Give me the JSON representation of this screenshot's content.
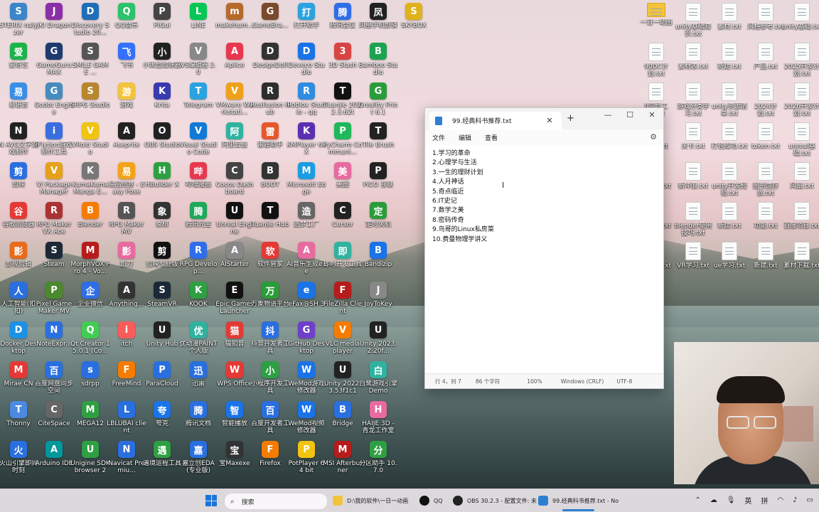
{
  "desktop": {
    "icons": [
      {
        "label": "STERIX nalyzer",
        "color": "#3a86c8"
      },
      {
        "label": "JKI Dragon",
        "color": "#8b2fa8"
      },
      {
        "label": "Discovery Studio 20...",
        "color": "#1e6fb8"
      },
      {
        "label": "QQ音乐",
        "color": "#2cc36b"
      },
      {
        "label": "PIGui",
        "color": "#444"
      },
      {
        "label": "LINE",
        "color": "#06c755"
      },
      {
        "label": "makehum...",
        "color": "#b56a2c"
      },
      {
        "label": "GameBra...",
        "color": "#7a4a2c"
      },
      {
        "label": "打开助手",
        "color": "#2aa3e0"
      },
      {
        "label": "腾讯会议",
        "color": "#2f6ee8"
      },
      {
        "label": "凤凰手机影驿",
        "color": "#222"
      },
      {
        "label": "SKYBOX",
        "color": "#e0b21a"
      },
      {
        "label": "爱奇艺",
        "color": "#1bb34a"
      },
      {
        "label": "GameGuru MAX",
        "color": "#1f3a6e"
      },
      {
        "label": "SMILE GAME ...",
        "color": "#555"
      },
      {
        "label": "飞书",
        "color": "#3370ff"
      },
      {
        "label": "小黑盒加速器",
        "color": "#222"
      },
      {
        "label": "VS编辑器 2.0",
        "color": "#888"
      },
      {
        "label": "Aplice",
        "color": "#e8384f"
      },
      {
        "label": "DesignDoll",
        "color": "#333"
      },
      {
        "label": "Deveco Studio",
        "color": "#1a73e8"
      },
      {
        "label": "3D Slash",
        "color": "#d94343"
      },
      {
        "label": "Bamboo Studio",
        "color": "#1ca34f"
      },
      {
        "label": "易语言",
        "color": "#3a8ee6"
      },
      {
        "label": "Godot Engine",
        "color": "#478cbf"
      },
      {
        "label": "SRPG Studio",
        "color": "#b8862d"
      },
      {
        "label": "游戏",
        "color": "#f3c33c"
      },
      {
        "label": "Krita",
        "color": "#3a3ab0"
      },
      {
        "label": "Telegram",
        "color": "#2aa3e0"
      },
      {
        "label": "VMware Workstati...",
        "color": "#f0a11a"
      },
      {
        "label": "Reallusion Hub",
        "color": "#2d2d2d"
      },
      {
        "label": "Roblox Studio - qq",
        "color": "#2f8ce0"
      },
      {
        "label": "Tuanjie 2022.3.62t",
        "color": "#111"
      },
      {
        "label": "Greality Print 6.1",
        "color": "#2a9d3a"
      },
      {
        "label": "N AVG文字游戏制作",
        "color": "#222"
      },
      {
        "label": "iFlytion游戏制作工具",
        "color": "#3a6ee0"
      },
      {
        "label": "VRoid Studio",
        "color": "#f1c40f"
      },
      {
        "label": "Aseprite",
        "color": "#222"
      },
      {
        "label": "OBS Studio",
        "color": "#222"
      },
      {
        "label": "Visual Studio Code",
        "color": "#0f7bd6"
      },
      {
        "label": "阿里云盘",
        "color": "#2fb3a0"
      },
      {
        "label": "雷霆助手",
        "color": "#e5572c"
      },
      {
        "label": "KMPlayer 64X",
        "color": "#5a2fb0"
      },
      {
        "label": "PyCharm Communi...",
        "color": "#1fb85a"
      },
      {
        "label": "Tile Brush",
        "color": "#222"
      },
      {
        "label": "剪映",
        "color": "#2a6fe0"
      },
      {
        "label": "VI Package Manager",
        "color": "#e5a11a"
      },
      {
        "label": "KumaKuma Manga E...",
        "color": "#777"
      },
      {
        "label": "易品创意 - Easy Pose",
        "color": "#f3a21a"
      },
      {
        "label": "HBuilder X",
        "color": "#2ea043"
      },
      {
        "label": "哔哩漫画",
        "color": "#e8384f"
      },
      {
        "label": "Cocos Dashboard",
        "color": "#444"
      },
      {
        "label": "BOOT",
        "color": "#333"
      },
      {
        "label": "Microsoft Edge",
        "color": "#1b9de2"
      },
      {
        "label": "美图",
        "color": "#e86ba0"
      },
      {
        "label": "PICO 互联",
        "color": "#222"
      },
      {
        "label": "谷歌浏览器",
        "color": "#e53935"
      },
      {
        "label": "RPG Maker VX Ace",
        "color": "#a33"
      },
      {
        "label": "Blender",
        "color": "#f57c00"
      },
      {
        "label": "RPG Maker MV",
        "color": "#555"
      },
      {
        "label": "象棋",
        "color": "#333"
      },
      {
        "label": "腾讯元宝",
        "color": "#1ea85a"
      },
      {
        "label": "Unreal Engine",
        "color": "#111"
      },
      {
        "label": "Tuanjie Hub",
        "color": "#111"
      },
      {
        "label": "造梦工厂",
        "color": "#666"
      },
      {
        "label": "Cursor",
        "color": "#222"
      },
      {
        "label": "定时关机",
        "color": "#2a9d3a"
      },
      {
        "label": "影视剪辑",
        "color": "#e86a1a"
      },
      {
        "label": "Steam",
        "color": "#1b2838"
      },
      {
        "label": "MorphVOX Pro 4 - Vo...",
        "color": "#b71c1c"
      },
      {
        "label": "影刀",
        "color": "#e86ba0"
      },
      {
        "label": "剪映专业版",
        "color": "#111"
      },
      {
        "label": "RPG Develop...",
        "color": "#2f6ee8"
      },
      {
        "label": "AIStarter",
        "color": "#888"
      },
      {
        "label": "软件管家",
        "color": "#e53935"
      },
      {
        "label": "AI音乐生成exe",
        "color": "#e86ba0"
      },
      {
        "label": "即时开发工具",
        "color": "#2fb3a0"
      },
      {
        "label": "Bandizip",
        "color": "#1a73e8"
      },
      {
        "label": "人工智能(扣扣)",
        "color": "#2a6fe0"
      },
      {
        "label": "Pixel Game Maker MV",
        "color": "#4a8a2c"
      },
      {
        "label": "企业微信",
        "color": "#2f6ee8"
      },
      {
        "label": "Anything...",
        "color": "#333"
      },
      {
        "label": "SteamVR",
        "color": "#1b2838"
      },
      {
        "label": "KOOK",
        "color": "#2ea043"
      },
      {
        "label": "Epic Games Launcher",
        "color": "#111"
      },
      {
        "label": "万象物语平台",
        "color": "#2a9d3a"
      },
      {
        "label": "eFax@SH 3",
        "color": "#1a73e8"
      },
      {
        "label": "FileZilla Client",
        "color": "#b71c1c"
      },
      {
        "label": "JoyToKey",
        "color": "#888"
      },
      {
        "label": "Docker Desktop",
        "color": "#1d91e6"
      },
      {
        "label": "NoteExpr...",
        "color": "#2a6fe0"
      },
      {
        "label": "Qt Creator 15.0.1 (Co...",
        "color": "#41cd52"
      },
      {
        "label": "itch",
        "color": "#fa5c5c"
      },
      {
        "label": "Unity Hub",
        "color": "#222"
      },
      {
        "label": "优动漫PAINT 个人版",
        "color": "#2fb3a0"
      },
      {
        "label": "猫知音",
        "color": "#e53935"
      },
      {
        "label": "抖音开发者工具",
        "color": "#2a6fe0"
      },
      {
        "label": "GitHub Desktop",
        "color": "#6e40c9"
      },
      {
        "label": "VLC media player",
        "color": "#f57c00"
      },
      {
        "label": "Unity 2023.2.20f...",
        "color": "#222"
      },
      {
        "label": "Mirae CN",
        "color": "#e53935"
      },
      {
        "label": "百度网盘同步空间",
        "color": "#2a6fe0"
      },
      {
        "label": "sdrpp",
        "color": "#2a6fe0"
      },
      {
        "label": "FreeMind",
        "color": "#f57c00"
      },
      {
        "label": "ParaCloud",
        "color": "#2a6fe0"
      },
      {
        "label": "迅雷",
        "color": "#2a6fe0"
      },
      {
        "label": "WPS Office",
        "color": "#e53935"
      },
      {
        "label": "小程序开发工具",
        "color": "#2ea043"
      },
      {
        "label": "WeMod游戏修改器",
        "color": "#1a73e8"
      },
      {
        "label": "Unity 2022.3.53f1c1",
        "color": "#222"
      },
      {
        "label": "白鹭游戏引擎 Demo",
        "color": "#2fb3a0"
      },
      {
        "label": "Thonny",
        "color": "#4a8ae0"
      },
      {
        "label": "CiteSpace",
        "color": "#666"
      },
      {
        "label": "MEGA12",
        "color": "#2ea043"
      },
      {
        "label": "LBLUBAI client",
        "color": "#2a6fe0"
      },
      {
        "label": "夸克",
        "color": "#1a73e8"
      },
      {
        "label": "腾讯文档",
        "color": "#2a6fe0"
      },
      {
        "label": "智能播放",
        "color": "#1a73e8"
      },
      {
        "label": "百度开发者工具",
        "color": "#2a6fe0"
      },
      {
        "label": "WeMod视频修改器",
        "color": "#1a73e8"
      },
      {
        "label": "Bridge",
        "color": "#2a6fe0"
      },
      {
        "label": "HAIJE 3D - 青龙工作室",
        "color": "#e86ba0"
      },
      {
        "label": "火山引擎即同时刻",
        "color": "#2a6fe0"
      },
      {
        "label": "Arduino IDE",
        "color": "#00979d"
      },
      {
        "label": "Unigine SDK browser 2",
        "color": "#2ea043"
      },
      {
        "label": "Navicat Premiu...",
        "color": "#2a6fe0"
      },
      {
        "label": "遇境运程工具",
        "color": "#2ea043"
      },
      {
        "label": "嘉立创EDA(专业版)",
        "color": "#2a6fe0"
      },
      {
        "label": "宝Maxexe",
        "color": "#333"
      },
      {
        "label": "Firefox",
        "color": "#f57c00"
      },
      {
        "label": "PotPlayer 64 bit",
        "color": "#f1c40f"
      },
      {
        "label": "MSI Afterburner",
        "color": "#b71c1c"
      },
      {
        "label": "分区助手 10.7.0",
        "color": "#2ea043"
      }
    ],
    "files": [
      {
        "label": "一日一动画"
      },
      {
        "label": "unity基础知识.txt"
      },
      {
        "label": "素材.txt"
      },
      {
        "label": "风格参考.txt"
      },
      {
        "label": "unity基础.txt"
      },
      {
        "label": "90DC计划.txt"
      },
      {
        "label": "素材表.txt"
      },
      {
        "label": "新建.txt"
      },
      {
        "label": "产品.txt"
      },
      {
        "label": "2025开发计划.txt"
      },
      {
        "label": "9平台工具.txt"
      },
      {
        "label": "游戏分类学习.txt"
      },
      {
        "label": "unity资源清单.txt"
      },
      {
        "label": "2024计划.txt"
      },
      {
        "label": "2026开发计划.txt"
      },
      {
        "label": "任务.txt"
      },
      {
        "label": "关卡.txt"
      },
      {
        "label": "打包成功.txt"
      },
      {
        "label": "token.txt"
      },
      {
        "label": "unreal基础.txt"
      },
      {
        "label": "AI开发.txt"
      },
      {
        "label": "新冲浪.txt"
      },
      {
        "label": "unity开发经验.txt"
      },
      {
        "label": "图书馆存放.txt"
      },
      {
        "label": "风扇.txt"
      },
      {
        "label": "加速器.txt"
      },
      {
        "label": "blender使用技巧.txt"
      },
      {
        "label": "新建.txt"
      },
      {
        "label": "功能.txt"
      },
      {
        "label": "百度项目.txt"
      },
      {
        "label": "最新AI.txt"
      },
      {
        "label": "VR学习.txt"
      },
      {
        "label": "ue学习.txt"
      },
      {
        "label": "新建.txt"
      },
      {
        "label": "素材下载.txt"
      }
    ]
  },
  "notepad": {
    "tab_title": "99.经典科书推荐.txt",
    "menu": [
      "文件",
      "编辑",
      "查看"
    ],
    "lines": [
      "1.学习的革命",
      "2.心理学与生活",
      "3.一生的理财计划",
      "4.人月神话",
      "5.奇点临近",
      "6.IT史记",
      "7.数学之美",
      "8.密码传奇",
      "9.鸟哥的Linux私房菜",
      "10.费曼物理学讲义"
    ],
    "status": {
      "position": "行 4，列 7",
      "chars": "86 个字符",
      "zoom": "100%",
      "line_ending": "Windows (CRLF)",
      "encoding": "UTF-8"
    }
  },
  "taskbar": {
    "search_placeholder": "搜索",
    "items": [
      {
        "label": "D:\\我的软件\\一日一动画",
        "color": "#f3c33c"
      },
      {
        "label": "QQ",
        "color": "#111"
      },
      {
        "label": "OBS 30.2.3 - 配置文件: 未",
        "color": "#222"
      },
      {
        "label": "99.经典科书推荐.txt - No",
        "color": "#2d7fd3"
      }
    ],
    "tray": {
      "lang": "英",
      "ime": "拼"
    }
  }
}
